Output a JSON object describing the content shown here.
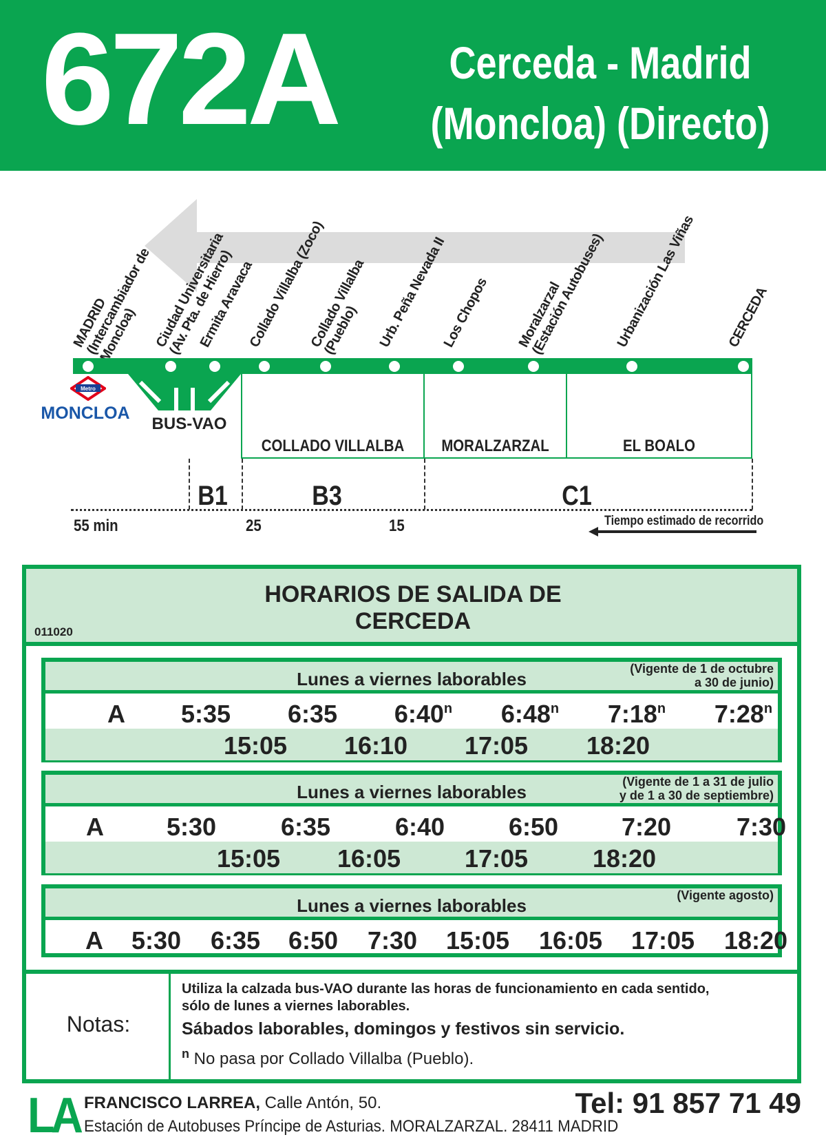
{
  "header": {
    "route": "672A",
    "title_line1": "Cerceda - Madrid",
    "title_line2": "(Moncloa) (Directo)",
    "color": "#0aa550"
  },
  "stops": [
    {
      "lines": [
        "MADRID",
        "(Intercambiador de",
        "Moncloa)"
      ]
    },
    {
      "lines": [
        "Ciudad Universitaria",
        "(Av. Pta. de Hierro)"
      ]
    },
    {
      "lines": [
        "Ermita Aravaca"
      ]
    },
    {
      "lines": [
        "Collado Villalba (Zoco)"
      ]
    },
    {
      "lines": [
        "Collado Villalba",
        "(Pueblo)"
      ]
    },
    {
      "lines": [
        "Urb. Peña Nevada II"
      ]
    },
    {
      "lines": [
        "Los Chopos"
      ]
    },
    {
      "lines": [
        "Moralzarzal",
        "(Estación Autobuses)"
      ]
    },
    {
      "lines": [
        "Urbanización Las Viñas"
      ]
    },
    {
      "lines": [
        "CERCEDA"
      ]
    }
  ],
  "metro": {
    "logo": "Metro",
    "station": "MONCLOA"
  },
  "busvao": "BUS-VAO",
  "zones": [
    "COLLADO VILLALBA",
    "MORALZARZAL",
    "EL BOALO"
  ],
  "fares": [
    "B1",
    "B3",
    "C1"
  ],
  "times_travel": {
    "t1": "55 min",
    "t2": "25",
    "t3": "15",
    "caption": "Tiempo estimado de recorrido"
  },
  "schedule": {
    "code": "011020",
    "title_line1": "HORARIOS DE SALIDA DE",
    "title_line2": "CERCEDA",
    "sections": [
      {
        "title": "Lunes a viernes laborables",
        "note1": "(Vigente de 1 de octubre",
        "note2": "a 30 de junio)",
        "letter": "A",
        "row1": [
          {
            "t": "5:35",
            "n": ""
          },
          {
            "t": "6:35",
            "n": ""
          },
          {
            "t": "6:40",
            "n": "n"
          },
          {
            "t": "6:48",
            "n": "n"
          },
          {
            "t": "7:18",
            "n": "n"
          },
          {
            "t": "7:28",
            "n": "n"
          }
        ],
        "row2": [
          "15:05",
          "16:10",
          "17:05",
          "18:20"
        ]
      },
      {
        "title": "Lunes a viernes laborables",
        "note1": "(Vigente de 1 a 31 de julio",
        "note2": "y de 1 a 30 de septiembre)",
        "letter": "A",
        "row1": [
          {
            "t": "5:30",
            "n": ""
          },
          {
            "t": "6:35",
            "n": ""
          },
          {
            "t": "6:40",
            "n": ""
          },
          {
            "t": "6:50",
            "n": ""
          },
          {
            "t": "7:20",
            "n": ""
          },
          {
            "t": "7:30",
            "n": ""
          }
        ],
        "row2": [
          "15:05",
          "16:05",
          "17:05",
          "18:20"
        ]
      },
      {
        "title": "Lunes a viernes laborables",
        "note1": "(Vigente agosto)",
        "letter": "A",
        "row1": [
          "5:30",
          "6:35",
          "6:50",
          "7:30",
          "15:05",
          "16:05",
          "17:05",
          "18:20"
        ]
      }
    ]
  },
  "notes": {
    "label": "Notas:",
    "line1": "Utiliza la calzada bus-VAO durante las horas de funcionamiento en cada sentido,",
    "line2": "sólo de lunes a viernes laborables.",
    "line3": "Sábados laborables, domingos y festivos sin servicio.",
    "footnote_mark": "n",
    "footnote": "No pasa por Collado Villalba (Pueblo)."
  },
  "footer": {
    "logo": "LA",
    "company": "FRANCISCO LARREA,",
    "address1": " Calle Antón, 50.",
    "address2": "Estación de Autobuses Príncipe de Asturias. MORALZARZAL. 28411 MADRID",
    "tel": "Tel: 91 857 71 49"
  }
}
